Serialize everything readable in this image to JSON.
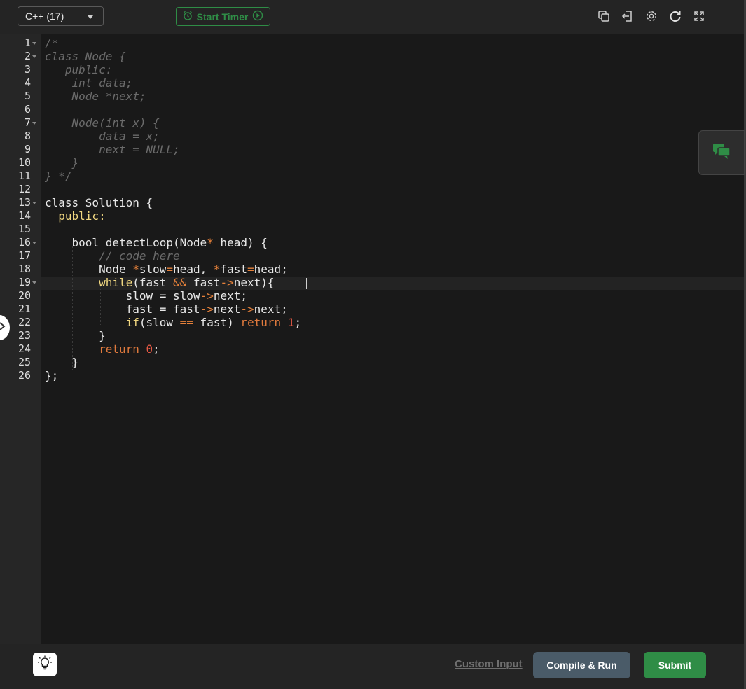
{
  "toolbar": {
    "language": "C++ (17)",
    "timer_label": "Start Timer",
    "icons": [
      "copy-icon",
      "exit-icon",
      "settings-gear-icon",
      "reset-icon",
      "fullscreen-icon"
    ]
  },
  "editor": {
    "active_line": 22,
    "line_numbers": [
      "1",
      "2",
      "3",
      "4",
      "5",
      "6",
      "7",
      "8",
      "9",
      "10",
      "11",
      "12",
      "13",
      "14",
      "15",
      "16",
      "17",
      "18",
      "19",
      "20",
      "21",
      "22",
      "23",
      "24",
      "25",
      "26"
    ],
    "folded_lines": [
      1,
      2,
      7,
      13,
      16,
      19
    ],
    "lines": [
      "/*",
      "class Node {",
      "   public:",
      "    int data;",
      "    Node *next;",
      "",
      "    Node(int x) {",
      "        data = x;",
      "        next = NULL;",
      "    }",
      "} */",
      "",
      "class Solution {",
      "  public:",
      "",
      "    bool detectLoop(Node* head) {",
      "        // code here",
      "        Node *slow=head, *fast=head;",
      "        while(fast && fast->next){",
      "            slow = slow->next;",
      "            fast = fast->next->next;",
      "            if(slow == fast) return 1;",
      "        }",
      "        return 0;",
      "    }",
      "};"
    ]
  },
  "bottom": {
    "custom_input": "Custom Input",
    "compile_run": "Compile & Run",
    "submit": "Submit"
  },
  "colors": {
    "accent_green": "#2f8d46",
    "compile_button": "#4a5b68",
    "keyword": "#f0d780",
    "operator": "#e6813a",
    "number": "#ea5a45",
    "comment": "#6b6b6b"
  }
}
